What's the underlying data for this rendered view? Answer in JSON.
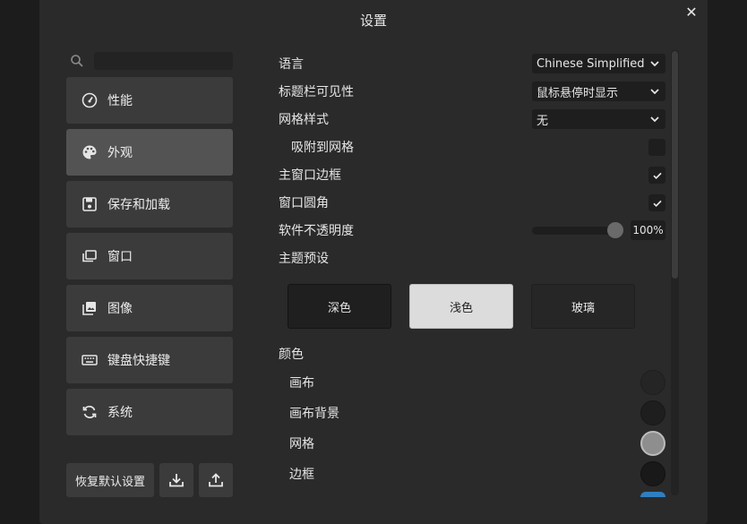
{
  "dialog": {
    "title": "设置",
    "close_glyph": "✕"
  },
  "sidebar": {
    "search": {
      "placeholder": "",
      "value": ""
    },
    "items": [
      {
        "label": "性能",
        "icon": "gauge-icon"
      },
      {
        "label": "外观",
        "icon": "palette-icon",
        "active": true
      },
      {
        "label": "保存和加载",
        "icon": "save-icon"
      },
      {
        "label": "窗口",
        "icon": "window-icon"
      },
      {
        "label": "图像",
        "icon": "image-icon"
      },
      {
        "label": "键盘快捷键",
        "icon": "keyboard-icon"
      },
      {
        "label": "系统",
        "icon": "sync-icon"
      }
    ],
    "restore_defaults_label": "恢复默认设置",
    "import_icon": "download-icon",
    "export_icon": "upload-icon"
  },
  "settings": {
    "language": {
      "label": "语言",
      "value": "Chinese Simplified"
    },
    "titlebar_visibility": {
      "label": "标题栏可见性",
      "value": "鼠标悬停时显示"
    },
    "grid_style": {
      "label": "网格样式",
      "value": "无"
    },
    "snap_to_grid": {
      "label": "吸附到网格",
      "checked": false
    },
    "main_window_border": {
      "label": "主窗口边框",
      "checked": true
    },
    "window_rounded": {
      "label": "窗口圆角",
      "checked": true
    },
    "opacity": {
      "label": "软件不透明度",
      "value": "100%",
      "level": 1.0
    },
    "theme_preset": {
      "label": "主题预设",
      "options": [
        "深色",
        "浅色",
        "玻璃"
      ],
      "selected": "浅色"
    },
    "colors": {
      "label": "颜色",
      "items": [
        {
          "label": "画布",
          "color": "#252525"
        },
        {
          "label": "画布背景",
          "color": "#1e1e1e"
        },
        {
          "label": "网格",
          "color": "#8e8e8e"
        },
        {
          "label": "边框",
          "color": "#191919"
        }
      ]
    }
  },
  "colors": {
    "dialog_bg": "#2a2a2a",
    "nav_bg": "#3b3b3b",
    "nav_active_bg": "#535353",
    "field_bg": "#1e1e1e",
    "light_theme_bg": "#dcdcdc"
  }
}
